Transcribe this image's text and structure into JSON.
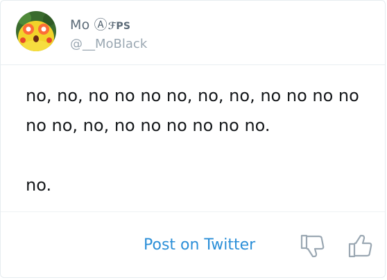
{
  "tweet": {
    "display_name": "Mo Ⓐ",
    "display_name_suffix": "ℱPS",
    "username": "@__MoBlack",
    "text": "no, no, no no no no, no, no, no no no no\nno no, no, no no no no no no.\n\nno."
  },
  "footer": {
    "post_label": "Post on Twitter"
  },
  "icons": {
    "thumbs_down": "thumbs-down-icon",
    "thumbs_up": "thumbs-up-icon"
  },
  "colors": {
    "link": "#2b8fd8",
    "name": "#5b6a77",
    "username": "#9aa7b2",
    "text": "#14171a",
    "icon": "#9aa7b2"
  }
}
